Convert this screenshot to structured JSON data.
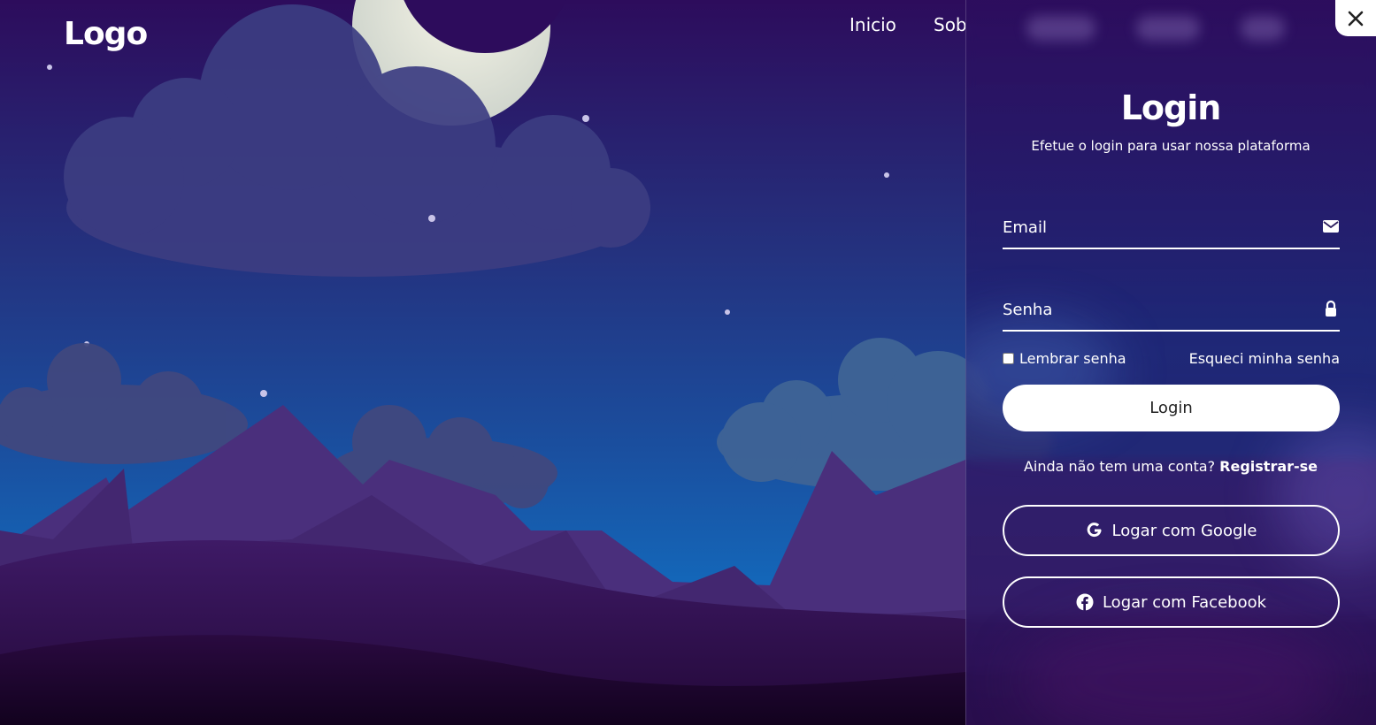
{
  "header": {
    "logo": "Logo",
    "nav": [
      "Inicio",
      "Sob"
    ]
  },
  "login": {
    "close_label": "×",
    "title": "Login",
    "subtitle": "Efetue o login para usar nossa plataforma",
    "email_placeholder": "Email",
    "password_placeholder": "Senha",
    "remember_label": "Lembrar senha",
    "forgot_label": "Esqueci minha senha",
    "submit_label": "Login",
    "register_prompt": "Ainda não tem uma conta?",
    "register_link": "Registrar-se",
    "google_label": "Logar com Google",
    "facebook_label": "Logar com Facebook"
  },
  "icons": {
    "close": "close-icon",
    "email": "mail-icon",
    "password": "lock-icon",
    "google": "google-icon",
    "facebook": "facebook-icon"
  },
  "colors": {
    "sky_top": "#2d0c5c",
    "sky_mid": "#1d3e96",
    "sky_bottom": "#1466b8",
    "accent": "#ffffff",
    "text_dark": "#222222"
  }
}
